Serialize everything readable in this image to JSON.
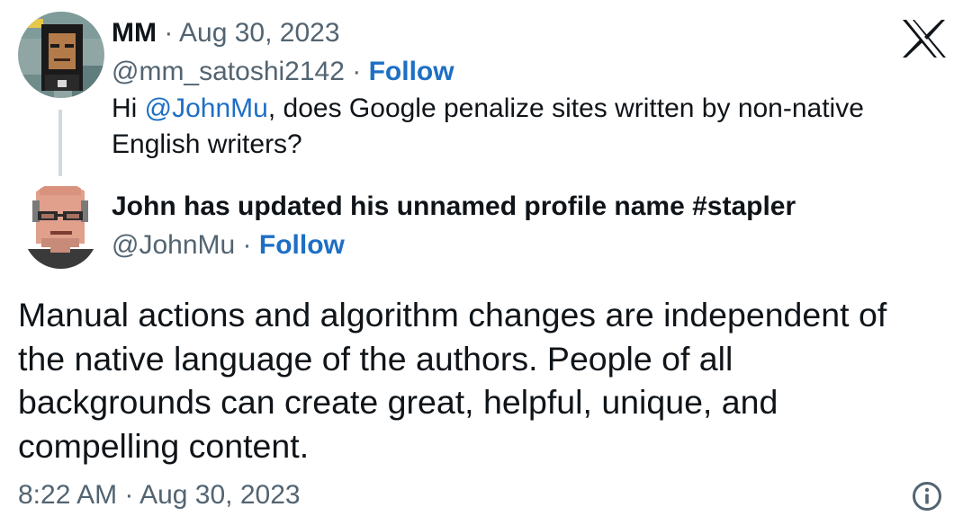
{
  "reply_to": {
    "author_name": "MM",
    "separator": "·",
    "date": "Aug 30, 2023",
    "handle": "@mm_satoshi2142",
    "follow_label": "Follow",
    "text_prefix": "Hi ",
    "mention": "@JohnMu",
    "text_line1_rest": ", does Google penalize sites written by non-native",
    "text_line2": "English writers?",
    "avatar_icon": "pixel-art-avatar-icon"
  },
  "post": {
    "author_name": "John has updated his unnamed profile name #stapler",
    "handle": "@JohnMu",
    "separator": "·",
    "follow_label": "Follow",
    "avatar_icon": "pixel-art-portrait-icon",
    "text_lines": [
      "Manual actions and algorithm changes are independent of",
      "the native language of the authors. People of all",
      "backgrounds can create great, helpful, unique, and",
      "compelling content."
    ],
    "timestamp": "8:22 AM · Aug 30, 2023"
  },
  "icons": {
    "brand": "x-logo-icon",
    "info": "info-icon"
  },
  "colors": {
    "text": "#0f1419",
    "muted": "#536471",
    "link": "#1d6fc4",
    "thread_line": "#cfd9de"
  }
}
